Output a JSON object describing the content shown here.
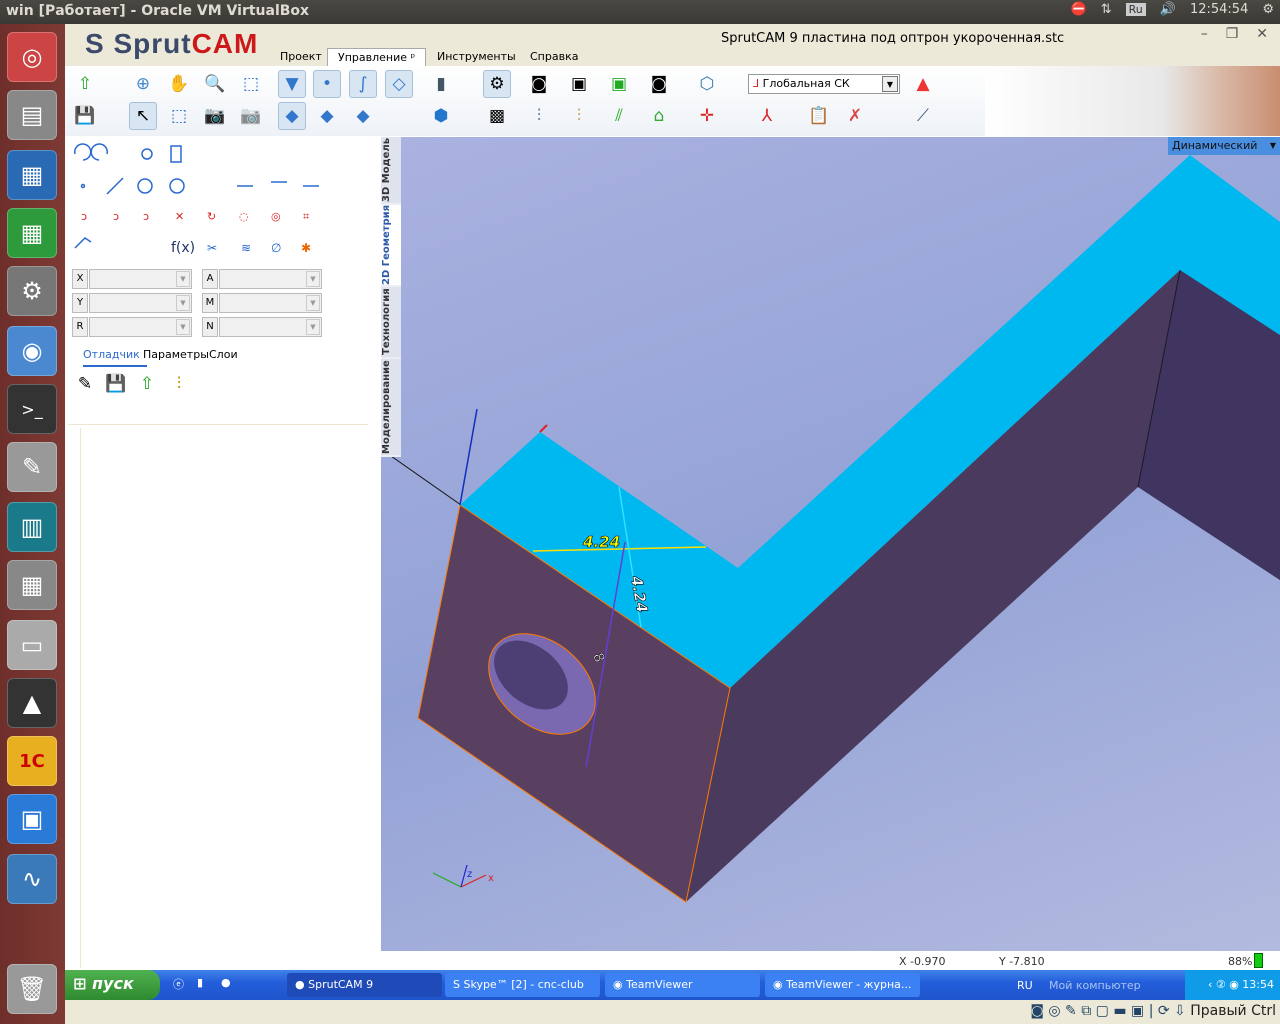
{
  "host": {
    "window_title": "win [Работает] - Oracle VM VirtualBox",
    "keyboard": "Ru",
    "clock": "12:54:54"
  },
  "launcher": {
    "items": [
      "ubuntu-icon",
      "files-icon",
      "writer-icon",
      "calc-icon",
      "settings-icon",
      "chromium-icon",
      "terminal-icon",
      "editor-icon",
      "book-icon",
      "calculator-icon",
      "scanner-icon",
      "inkscape-icon",
      "1c-icon",
      "virtualbox-icon",
      "monitor-icon",
      "trash-icon"
    ]
  },
  "app": {
    "logo": "SprutCAM",
    "title": "SprutCAM 9   пластина под оптрон укороченная.stc",
    "menu": [
      "Проект",
      "Управление",
      "Инструменты",
      "Справка"
    ],
    "cs_select": "Глобальная СК",
    "view_mode": "Динамический",
    "vtabs": [
      "3D Модель",
      "2D Геометрия",
      "Технология",
      "Моделирование"
    ],
    "fields_left": [
      "X",
      "Y",
      "R"
    ],
    "fields_right": [
      "A",
      "M",
      "N"
    ],
    "panel_tabs": [
      "Отладчик",
      "Параметры",
      "Слои"
    ],
    "dims": {
      "d1": "4.24",
      "d2": "4.24",
      "d3": "8"
    },
    "status": {
      "x": "X -0.970",
      "y": "Y -7.810",
      "pct": "88%"
    }
  },
  "colors": {
    "top_face": "#00b8f0",
    "front_face": "#5a4060",
    "side_face": "#4a3a5e",
    "edge": "#ff7a00"
  },
  "taskbar": {
    "start": "пуск",
    "tasks": [
      "SprutCAM 9",
      "Skype™ [2] - cnc-club",
      "TeamViewer",
      "TeamViewer - журна..."
    ],
    "lang": "RU",
    "mycomp": "Мой компьютер",
    "time": "13:54"
  },
  "vbox": {
    "host_key": "Правый Ctrl"
  }
}
